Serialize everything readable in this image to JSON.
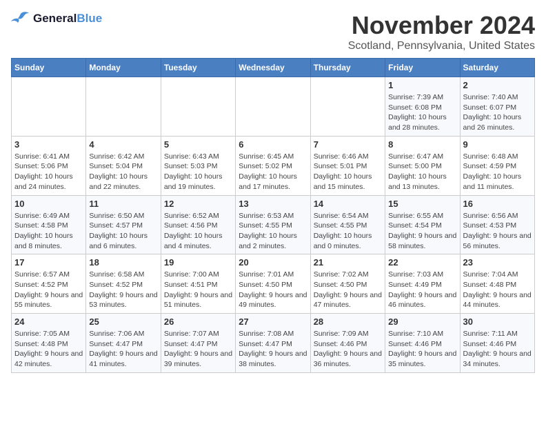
{
  "logo": {
    "line1": "General",
    "line2": "Blue"
  },
  "title": "November 2024",
  "subtitle": "Scotland, Pennsylvania, United States",
  "weekdays": [
    "Sunday",
    "Monday",
    "Tuesday",
    "Wednesday",
    "Thursday",
    "Friday",
    "Saturday"
  ],
  "weeks": [
    [
      {
        "day": "",
        "info": ""
      },
      {
        "day": "",
        "info": ""
      },
      {
        "day": "",
        "info": ""
      },
      {
        "day": "",
        "info": ""
      },
      {
        "day": "",
        "info": ""
      },
      {
        "day": "1",
        "info": "Sunrise: 7:39 AM\nSunset: 6:08 PM\nDaylight: 10 hours and 28 minutes."
      },
      {
        "day": "2",
        "info": "Sunrise: 7:40 AM\nSunset: 6:07 PM\nDaylight: 10 hours and 26 minutes."
      }
    ],
    [
      {
        "day": "3",
        "info": "Sunrise: 6:41 AM\nSunset: 5:06 PM\nDaylight: 10 hours and 24 minutes."
      },
      {
        "day": "4",
        "info": "Sunrise: 6:42 AM\nSunset: 5:04 PM\nDaylight: 10 hours and 22 minutes."
      },
      {
        "day": "5",
        "info": "Sunrise: 6:43 AM\nSunset: 5:03 PM\nDaylight: 10 hours and 19 minutes."
      },
      {
        "day": "6",
        "info": "Sunrise: 6:45 AM\nSunset: 5:02 PM\nDaylight: 10 hours and 17 minutes."
      },
      {
        "day": "7",
        "info": "Sunrise: 6:46 AM\nSunset: 5:01 PM\nDaylight: 10 hours and 15 minutes."
      },
      {
        "day": "8",
        "info": "Sunrise: 6:47 AM\nSunset: 5:00 PM\nDaylight: 10 hours and 13 minutes."
      },
      {
        "day": "9",
        "info": "Sunrise: 6:48 AM\nSunset: 4:59 PM\nDaylight: 10 hours and 11 minutes."
      }
    ],
    [
      {
        "day": "10",
        "info": "Sunrise: 6:49 AM\nSunset: 4:58 PM\nDaylight: 10 hours and 8 minutes."
      },
      {
        "day": "11",
        "info": "Sunrise: 6:50 AM\nSunset: 4:57 PM\nDaylight: 10 hours and 6 minutes."
      },
      {
        "day": "12",
        "info": "Sunrise: 6:52 AM\nSunset: 4:56 PM\nDaylight: 10 hours and 4 minutes."
      },
      {
        "day": "13",
        "info": "Sunrise: 6:53 AM\nSunset: 4:55 PM\nDaylight: 10 hours and 2 minutes."
      },
      {
        "day": "14",
        "info": "Sunrise: 6:54 AM\nSunset: 4:55 PM\nDaylight: 10 hours and 0 minutes."
      },
      {
        "day": "15",
        "info": "Sunrise: 6:55 AM\nSunset: 4:54 PM\nDaylight: 9 hours and 58 minutes."
      },
      {
        "day": "16",
        "info": "Sunrise: 6:56 AM\nSunset: 4:53 PM\nDaylight: 9 hours and 56 minutes."
      }
    ],
    [
      {
        "day": "17",
        "info": "Sunrise: 6:57 AM\nSunset: 4:52 PM\nDaylight: 9 hours and 55 minutes."
      },
      {
        "day": "18",
        "info": "Sunrise: 6:58 AM\nSunset: 4:52 PM\nDaylight: 9 hours and 53 minutes."
      },
      {
        "day": "19",
        "info": "Sunrise: 7:00 AM\nSunset: 4:51 PM\nDaylight: 9 hours and 51 minutes."
      },
      {
        "day": "20",
        "info": "Sunrise: 7:01 AM\nSunset: 4:50 PM\nDaylight: 9 hours and 49 minutes."
      },
      {
        "day": "21",
        "info": "Sunrise: 7:02 AM\nSunset: 4:50 PM\nDaylight: 9 hours and 47 minutes."
      },
      {
        "day": "22",
        "info": "Sunrise: 7:03 AM\nSunset: 4:49 PM\nDaylight: 9 hours and 46 minutes."
      },
      {
        "day": "23",
        "info": "Sunrise: 7:04 AM\nSunset: 4:48 PM\nDaylight: 9 hours and 44 minutes."
      }
    ],
    [
      {
        "day": "24",
        "info": "Sunrise: 7:05 AM\nSunset: 4:48 PM\nDaylight: 9 hours and 42 minutes."
      },
      {
        "day": "25",
        "info": "Sunrise: 7:06 AM\nSunset: 4:47 PM\nDaylight: 9 hours and 41 minutes."
      },
      {
        "day": "26",
        "info": "Sunrise: 7:07 AM\nSunset: 4:47 PM\nDaylight: 9 hours and 39 minutes."
      },
      {
        "day": "27",
        "info": "Sunrise: 7:08 AM\nSunset: 4:47 PM\nDaylight: 9 hours and 38 minutes."
      },
      {
        "day": "28",
        "info": "Sunrise: 7:09 AM\nSunset: 4:46 PM\nDaylight: 9 hours and 36 minutes."
      },
      {
        "day": "29",
        "info": "Sunrise: 7:10 AM\nSunset: 4:46 PM\nDaylight: 9 hours and 35 minutes."
      },
      {
        "day": "30",
        "info": "Sunrise: 7:11 AM\nSunset: 4:46 PM\nDaylight: 9 hours and 34 minutes."
      }
    ]
  ]
}
